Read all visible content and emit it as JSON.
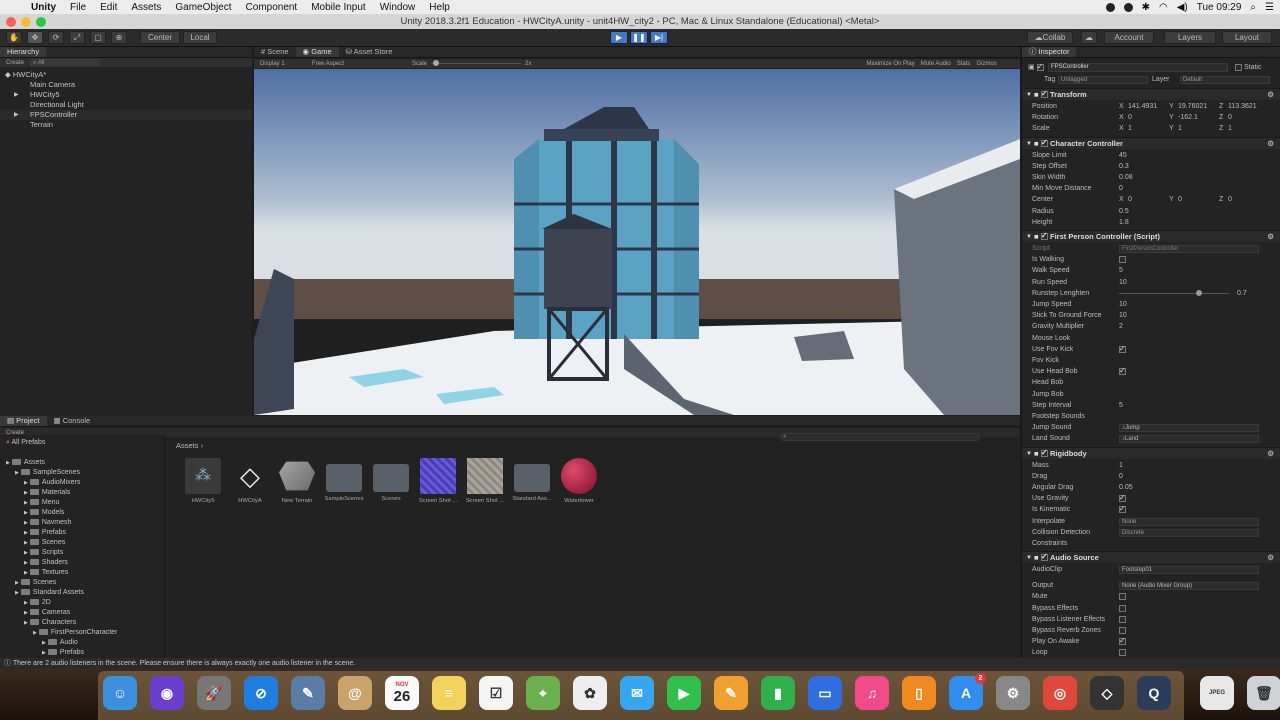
{
  "menubar": {
    "items": [
      "Unity",
      "File",
      "Edit",
      "Assets",
      "GameObject",
      "Component",
      "Mobile Input",
      "Window",
      "Help"
    ],
    "clock": "Tue 09:29"
  },
  "window": {
    "title": "Unity 2018.3.2f1 Education - HWCityA.unity - unit4HW_city2 - PC, Mac & Linux Standalone (Educational) <Metal>"
  },
  "toolbar": {
    "center": "Center",
    "local": "Local",
    "collab": "Collab",
    "account": "Account",
    "layers": "Layers",
    "layout": "Layout"
  },
  "hierarchy": {
    "tab": "Hierarchy",
    "create": "Create",
    "search_placeholder": "All",
    "scene": "HWCityA*",
    "items": [
      "Main Camera",
      "HWCity5",
      "Directional Light",
      "FPSController",
      "Terrain"
    ]
  },
  "game": {
    "tabs": [
      "Scene",
      "Game",
      "Asset Store"
    ],
    "display": "Display 1",
    "aspect": "Free Aspect",
    "scale_label": "Scale",
    "scale_value": "2x",
    "options": [
      "Maximize On Play",
      "Mute Audio",
      "Stats",
      "Gizmos"
    ]
  },
  "project": {
    "tabs": [
      "Project",
      "Console"
    ],
    "create": "Create",
    "favorite": "All Prefabs",
    "path": "Assets",
    "tree": [
      {
        "label": "Assets",
        "indent": 0
      },
      {
        "label": "SampleScenes",
        "indent": 1
      },
      {
        "label": "AudioMixers",
        "indent": 2
      },
      {
        "label": "Materials",
        "indent": 2
      },
      {
        "label": "Menu",
        "indent": 2
      },
      {
        "label": "Models",
        "indent": 2
      },
      {
        "label": "Navmesh",
        "indent": 2
      },
      {
        "label": "Prefabs",
        "indent": 2
      },
      {
        "label": "Scenes",
        "indent": 2
      },
      {
        "label": "Scripts",
        "indent": 2
      },
      {
        "label": "Shaders",
        "indent": 2
      },
      {
        "label": "Textures",
        "indent": 2
      },
      {
        "label": "Scenes",
        "indent": 1
      },
      {
        "label": "Standard Assets",
        "indent": 1
      },
      {
        "label": "2D",
        "indent": 2
      },
      {
        "label": "Cameras",
        "indent": 2
      },
      {
        "label": "Characters",
        "indent": 2
      },
      {
        "label": "FirstPersonCharacter",
        "indent": 3
      },
      {
        "label": "Audio",
        "indent": 4
      },
      {
        "label": "Prefabs",
        "indent": 4
      }
    ],
    "assets": [
      "HWCity5",
      "HWCityA",
      "New Terrain",
      "SampleScenes",
      "Scenes",
      "Screen Shot ...",
      "Screen Shot ...",
      "Standard Ass...",
      "Watertower"
    ]
  },
  "inspector": {
    "tab": "Inspector",
    "object": "FPSController",
    "static": "Static",
    "tag_label": "Tag",
    "tag": "Untagged",
    "layer_label": "Layer",
    "layer": "Default",
    "transform": {
      "title": "Transform",
      "position": [
        "141.4931",
        "19.76021",
        "113.3621"
      ],
      "rotation": [
        "0",
        "-162.1",
        "0"
      ],
      "scale": [
        "1",
        "1",
        "1"
      ]
    },
    "cc": {
      "title": "Character Controller",
      "rows": [
        [
          "Slope Limit",
          "45"
        ],
        [
          "Step Offset",
          "0.3"
        ],
        [
          "Skin Width",
          "0.08"
        ],
        [
          "Min Move Distance",
          "0"
        ]
      ],
      "center": [
        "0",
        "0",
        "0"
      ],
      "radius": "0.5",
      "height": "1.8"
    },
    "fpc": {
      "title": "First Person Controller (Script)",
      "script": "FirstPersonController",
      "rows": [
        [
          "Script",
          ""
        ],
        [
          "Is Walking",
          ""
        ],
        [
          "Walk Speed",
          "5"
        ],
        [
          "Run Speed",
          "10"
        ],
        [
          "Runstep Lenghten",
          "0.7"
        ],
        [
          "Jump Speed",
          "10"
        ],
        [
          "Stick To Ground Force",
          "10"
        ],
        [
          "Gravity Multiplier",
          "2"
        ],
        [
          "Mouse Look",
          ""
        ],
        [
          "Use Fov Kick",
          ""
        ],
        [
          "Fov Kick",
          ""
        ],
        [
          "Use Head Bob",
          ""
        ],
        [
          "Head Bob",
          ""
        ],
        [
          "Jump Bob",
          ""
        ],
        [
          "Step Interval",
          "5"
        ],
        [
          "Footstep Sounds",
          ""
        ],
        [
          "Jump Sound",
          "Jump"
        ],
        [
          "Land Sound",
          "Land"
        ]
      ]
    },
    "rb": {
      "title": "Rigidbody",
      "rows": [
        [
          "Mass",
          "1"
        ],
        [
          "Drag",
          "0"
        ],
        [
          "Angular Drag",
          "0.05"
        ],
        [
          "Use Gravity",
          ""
        ],
        [
          "Is Kinematic",
          ""
        ],
        [
          "Interpolate",
          "None"
        ],
        [
          "Collision Detection",
          "Discrete"
        ],
        [
          "Constraints",
          ""
        ]
      ]
    },
    "audio": {
      "title": "Audio Source",
      "rows": [
        [
          "AudioClip",
          "Footstep01"
        ],
        [
          "Output",
          "None (Audio Mixer Group)"
        ],
        [
          "Mute",
          ""
        ],
        [
          "Bypass Effects",
          ""
        ],
        [
          "Bypass Listener Effects",
          ""
        ],
        [
          "Bypass Reverb Zones",
          ""
        ],
        [
          "Play On Awake",
          ""
        ],
        [
          "Loop",
          ""
        ]
      ]
    }
  },
  "status": "There are 2 audio listeners in the scene. Please ensure there is always exactly one audio listener in the scene.",
  "dock": {
    "calendar_month": "NOV",
    "calendar_day": "26",
    "appstore_badge": "2",
    "jpeg_label": "JPEG"
  }
}
